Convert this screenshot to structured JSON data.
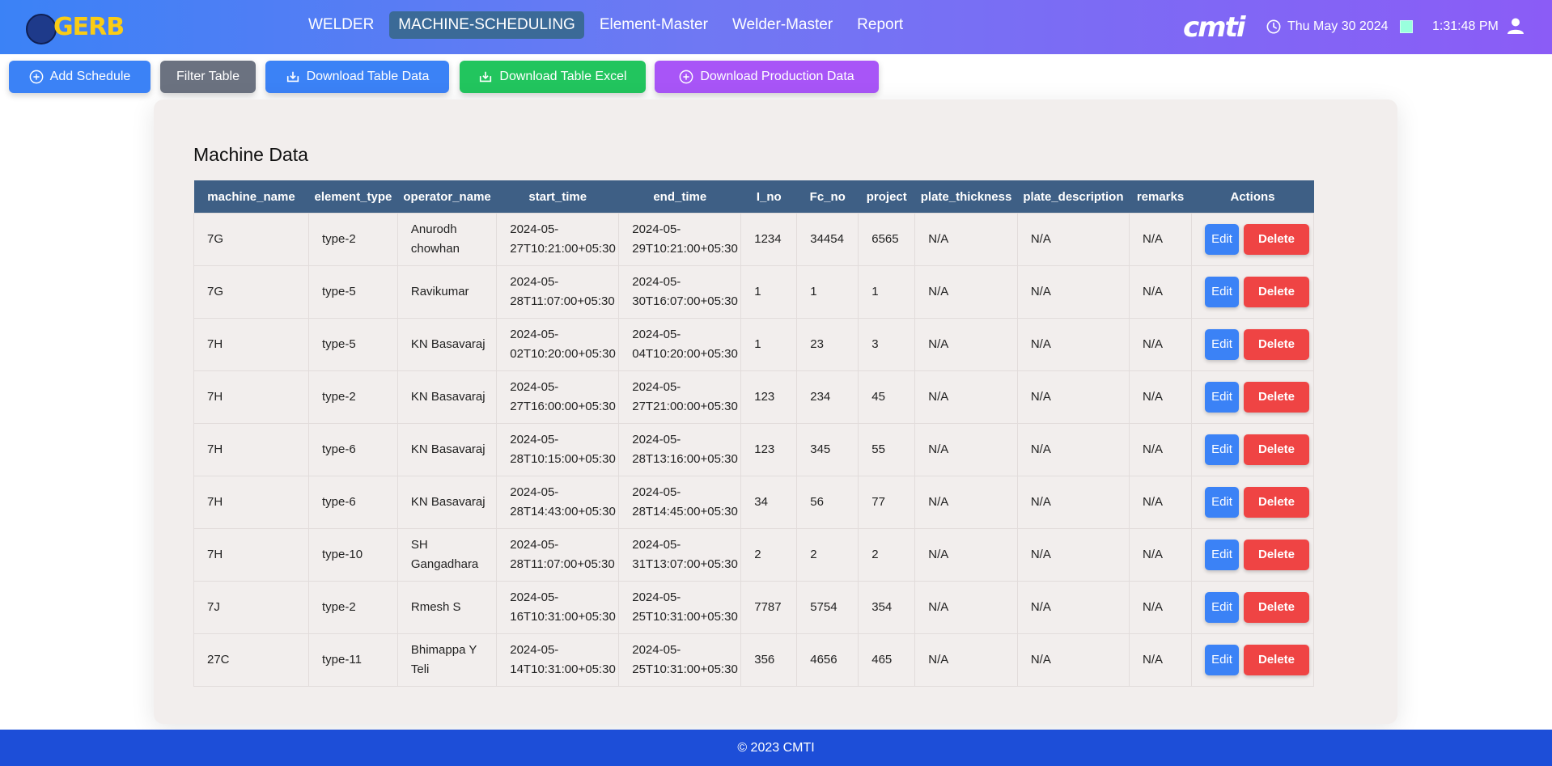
{
  "header": {
    "logo_text": "GERB",
    "nav": [
      "WELDER",
      "MACHINE-SCHEDULING",
      "Element-Master",
      "Welder-Master",
      "Report"
    ],
    "active_nav": "MACHINE-SCHEDULING",
    "brand": "cmti",
    "date": "Thu May 30 2024",
    "time": "1:31:48 PM",
    "icons": {
      "clock": "clock-icon",
      "user": "user-icon",
      "broken_image": "broken-image-icon"
    }
  },
  "toolbar": {
    "add_schedule": "Add Schedule",
    "filter_table": "Filter Table",
    "download_table_data": "Download Table Data",
    "download_table_excel": "Download Table Excel",
    "download_production_data": "Download Production Data"
  },
  "card": {
    "title": "Machine Data"
  },
  "table": {
    "columns": [
      "machine_name",
      "element_type",
      "operator_name",
      "start_time",
      "end_time",
      "I_no",
      "Fc_no",
      "project",
      "plate_thickness",
      "plate_description",
      "remarks",
      "Actions"
    ],
    "edit_label": "Edit",
    "delete_label": "Delete",
    "rows": [
      {
        "machine_name": "7G",
        "element_type": "type-2",
        "operator_name": "Anurodh chowhan",
        "start_time": "2024-05-27T10:21:00+05:30",
        "end_time": "2024-05-29T10:21:00+05:30",
        "I_no": "1234",
        "Fc_no": "34454",
        "project": "6565",
        "plate_thickness": "N/A",
        "plate_description": "N/A",
        "remarks": "N/A"
      },
      {
        "machine_name": "7G",
        "element_type": "type-5",
        "operator_name": "Ravikumar",
        "start_time": "2024-05-28T11:07:00+05:30",
        "end_time": "2024-05-30T16:07:00+05:30",
        "I_no": "1",
        "Fc_no": "1",
        "project": "1",
        "plate_thickness": "N/A",
        "plate_description": "N/A",
        "remarks": "N/A"
      },
      {
        "machine_name": "7H",
        "element_type": "type-5",
        "operator_name": "KN Basavaraj",
        "start_time": "2024-05-02T10:20:00+05:30",
        "end_time": "2024-05-04T10:20:00+05:30",
        "I_no": "1",
        "Fc_no": "23",
        "project": "3",
        "plate_thickness": "N/A",
        "plate_description": "N/A",
        "remarks": "N/A"
      },
      {
        "machine_name": "7H",
        "element_type": "type-2",
        "operator_name": "KN Basavaraj",
        "start_time": "2024-05-27T16:00:00+05:30",
        "end_time": "2024-05-27T21:00:00+05:30",
        "I_no": "123",
        "Fc_no": "234",
        "project": "45",
        "plate_thickness": "N/A",
        "plate_description": "N/A",
        "remarks": "N/A"
      },
      {
        "machine_name": "7H",
        "element_type": "type-6",
        "operator_name": "KN Basavaraj",
        "start_time": "2024-05-28T10:15:00+05:30",
        "end_time": "2024-05-28T13:16:00+05:30",
        "I_no": "123",
        "Fc_no": "345",
        "project": "55",
        "plate_thickness": "N/A",
        "plate_description": "N/A",
        "remarks": "N/A"
      },
      {
        "machine_name": "7H",
        "element_type": "type-6",
        "operator_name": "KN Basavaraj",
        "start_time": "2024-05-28T14:43:00+05:30",
        "end_time": "2024-05-28T14:45:00+05:30",
        "I_no": "34",
        "Fc_no": "56",
        "project": "77",
        "plate_thickness": "N/A",
        "plate_description": "N/A",
        "remarks": "N/A"
      },
      {
        "machine_name": "7H",
        "element_type": "type-10",
        "operator_name": "SH Gangadhara",
        "start_time": "2024-05-28T11:07:00+05:30",
        "end_time": "2024-05-31T13:07:00+05:30",
        "I_no": "2",
        "Fc_no": "2",
        "project": "2",
        "plate_thickness": "N/A",
        "plate_description": "N/A",
        "remarks": "N/A"
      },
      {
        "machine_name": "7J",
        "element_type": "type-2",
        "operator_name": "Rmesh S",
        "start_time": "2024-05-16T10:31:00+05:30",
        "end_time": "2024-05-25T10:31:00+05:30",
        "I_no": "7787",
        "Fc_no": "5754",
        "project": "354",
        "plate_thickness": "N/A",
        "plate_description": "N/A",
        "remarks": "N/A"
      },
      {
        "machine_name": "27C",
        "element_type": "type-11",
        "operator_name": "Bhimappa Y Teli",
        "start_time": "2024-05-14T10:31:00+05:30",
        "end_time": "2024-05-25T10:31:00+05:30",
        "I_no": "356",
        "Fc_no": "4656",
        "project": "465",
        "plate_thickness": "N/A",
        "plate_description": "N/A",
        "remarks": "N/A"
      }
    ]
  },
  "footer": {
    "text": "© 2023 CMTI"
  },
  "colors": {
    "header_start": "#3b82f6",
    "header_end": "#8b5cf6",
    "table_header": "#3e5f85",
    "footer": "#1d4ed8",
    "delete": "#ef4444",
    "edit": "#3b82f6",
    "excel": "#22c55e",
    "production": "#a855f7",
    "filter": "#6b7280"
  }
}
